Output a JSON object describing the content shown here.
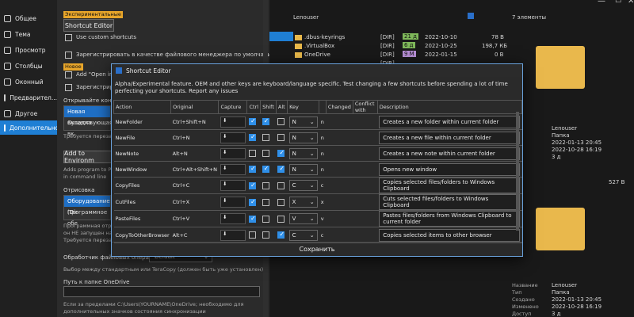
{
  "sidebar": {
    "items": [
      {
        "label": "Общее",
        "icon": "sliders-icon"
      },
      {
        "label": "Тема",
        "icon": "palette-icon"
      },
      {
        "label": "Просмотр",
        "icon": "eye-icon"
      },
      {
        "label": "Столбцы",
        "icon": "columns-icon"
      },
      {
        "label": "Оконный",
        "icon": "window-icon"
      },
      {
        "label": "Предварител...",
        "icon": "preview-icon"
      },
      {
        "label": "Другое",
        "icon": "gear-icon"
      },
      {
        "label": "Дополнительно",
        "icon": "code-icon"
      }
    ]
  },
  "settings": {
    "experimental_tag": "Экспериментальные",
    "shortcut_editor_btn": "Shortcut Editor",
    "use_custom_shortcuts": "Use custom shortcuts",
    "register_fm": "Зарегистрировать в качестве файлового менеджера по умолчанию",
    "new_tag": "Новое",
    "add_open_in": "Add \"Open in O",
    "register_short": "Зарегистрирова",
    "open_context": "Открывайте контекс",
    "list1": [
      "Новая вкладка",
      "Существующая вк"
    ],
    "restart_required1": "Требуется перезапу",
    "add_to_env": "Add to Environm",
    "adds_program": "Adds program to Pat",
    "in_command_line": "in command line",
    "render_label": "Отрисовка",
    "list2": [
      "Оборудование (Dir",
      "Программное обе"
    ],
    "render_desc1": "Программная отрис",
    "render_desc2": "он НЕ запущен на",
    "restart_required2": "Требуется перезапу",
    "file_ops_label": "Обработчик файловых операций",
    "file_ops_value": "Default",
    "file_ops_desc": "Выбор между стандартным или TeraCopy (должен быть уже установлен)",
    "onedrive_label": "Путь к папке OneDrive",
    "onedrive_value": "",
    "onedrive_desc1": "Если за пределами C:\\Users\\YOURNAME\\OneDrive; необходимо для",
    "onedrive_desc2": "дополнительных значков состояния синхронизации"
  },
  "explorer": {
    "location": "Lenouser",
    "item_count": "7 элементы",
    "size_header_right": "527 B",
    "files": [
      {
        "name": ".dbus-keyrings",
        "type": "[DIR]",
        "badge": "21 д",
        "date": "2022-10-10",
        "size": "78 B"
      },
      {
        "name": ".VirtualBox",
        "type": "[DIR]",
        "badge": "6 д",
        "date": "2022-10-25",
        "size": "198,7 КБ"
      },
      {
        "name": "OneDrive",
        "type": "[DIR]",
        "badge": "9 М",
        "date": "2022-01-15",
        "size": "0 B"
      },
      {
        "name": "",
        "type": "[DIR]",
        "badge": "",
        "date": "",
        "size": ""
      }
    ],
    "detail1": {
      "name": "Lenouser",
      "type": "Папка",
      "created": "2022-01-13  20:45",
      "modified": "2022-10-28  16:19",
      "age": "3 д"
    },
    "detail2": {
      "labels": [
        "Название",
        "Тип",
        "Создано",
        "Изменено",
        "Доступ"
      ],
      "name": "Lenouser",
      "type": "Папка",
      "created": "2022-01-13  20:45",
      "modified": "2022-10-28  16:19",
      "age": "3 д"
    }
  },
  "dialog": {
    "title": "Shortcut Editor",
    "notice": "Alpha/Experimental feature. OEM and other keys are keyboard/language specific. Test changing a few shortcuts before spending a lot of time perfecting your shortcuts. Report any issues",
    "headers": [
      "Action",
      "Original",
      "Capture",
      "Ctrl",
      "Shift",
      "Alt",
      "Key",
      "",
      "Changed",
      "Conflict with",
      "Description"
    ],
    "rows": [
      {
        "action": "NewFolder",
        "original": "Ctrl+Shift+N",
        "ctrl": true,
        "shift": true,
        "alt": false,
        "key": "N",
        "changed": "n",
        "desc": "Creates a new folder within current folder"
      },
      {
        "action": "NewFile",
        "original": "Ctrl+N",
        "ctrl": true,
        "shift": false,
        "alt": false,
        "key": "N",
        "changed": "n",
        "desc": "Creates a new file within current folder"
      },
      {
        "action": "NewNote",
        "original": "Alt+N",
        "ctrl": false,
        "shift": false,
        "alt": true,
        "key": "N",
        "changed": "n",
        "desc": "Creates a new note within current folder"
      },
      {
        "action": "NewWindow",
        "original": "Ctrl+Alt+Shift+N",
        "ctrl": true,
        "shift": true,
        "alt": true,
        "key": "N",
        "changed": "n",
        "desc": "Opens new window"
      },
      {
        "action": "CopyFiles",
        "original": "Ctrl+C",
        "ctrl": true,
        "shift": false,
        "alt": false,
        "key": "C",
        "changed": "c",
        "desc": "Copies selected files/folders to Windows Clipboard"
      },
      {
        "action": "CutFiles",
        "original": "Ctrl+X",
        "ctrl": true,
        "shift": false,
        "alt": false,
        "key": "X",
        "changed": "x",
        "desc": "Cuts selected files/folders to Windows Clipboard"
      },
      {
        "action": "PasteFiles",
        "original": "Ctrl+V",
        "ctrl": true,
        "shift": false,
        "alt": false,
        "key": "V",
        "changed": "v",
        "desc": "Pastes files/folders from Windows Clipboard to current folder"
      },
      {
        "action": "CopyToOtherBrowser",
        "original": "Alt+C",
        "ctrl": false,
        "shift": false,
        "alt": true,
        "key": "C",
        "changed": "c",
        "desc": "Copies selected items to other browser"
      }
    ],
    "save_label": "Сохранить"
  },
  "colors": {
    "accent": "#1f7fd4",
    "dialog_border": "#6aa2dc",
    "folder": "#e9b84c",
    "tag": "#e7a52a"
  }
}
